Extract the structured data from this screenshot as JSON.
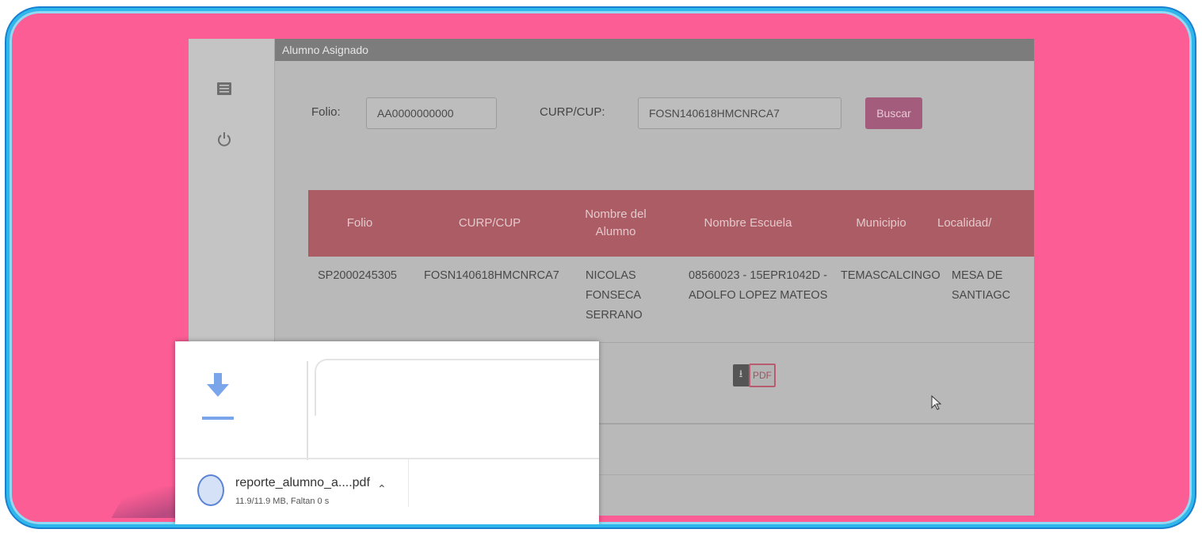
{
  "panel": {
    "title": "Alumno Asignado"
  },
  "search": {
    "folio_label": "Folio:",
    "folio_value": "AA0000000000",
    "curp_label": "CURP/CUP:",
    "curp_value": "FOSN140618HMCNRCA7",
    "button_label": "Buscar"
  },
  "table": {
    "headers": [
      "Folio",
      "CURP/CUP",
      "Nombre del Alumno",
      "Nombre Escuela",
      "Municipio",
      "Localidad/"
    ],
    "rows": [
      [
        "SP2000245305",
        "FOSN140618HMCNRCA7",
        "NICOLAS FONSECA SERRANO",
        "08560023 - 15EPR1042D - ADOLFO LOPEZ MATEOS",
        "TEMASCALCINGO",
        "MESA DE SANTIAGC"
      ]
    ]
  },
  "actions": {
    "pdf_label": "PDF"
  },
  "downloads": {
    "file_name": "reporte_alumno_a....pdf",
    "status": "11.9/11.9 MB, Faltan 0 s"
  },
  "colors": {
    "frame_bg": "#fb5d94",
    "frame_border": "#2eb7ea",
    "table_header": "#ac5c65",
    "buscar_button": "#a35c7b",
    "download_icon": "#7aa5ea"
  },
  "icons": {
    "sidebar": [
      "list-icon",
      "power-icon"
    ],
    "actions": [
      "download-icon"
    ],
    "downloads": [
      "download-arrow-icon",
      "file-icon",
      "chevron-up-icon"
    ]
  }
}
